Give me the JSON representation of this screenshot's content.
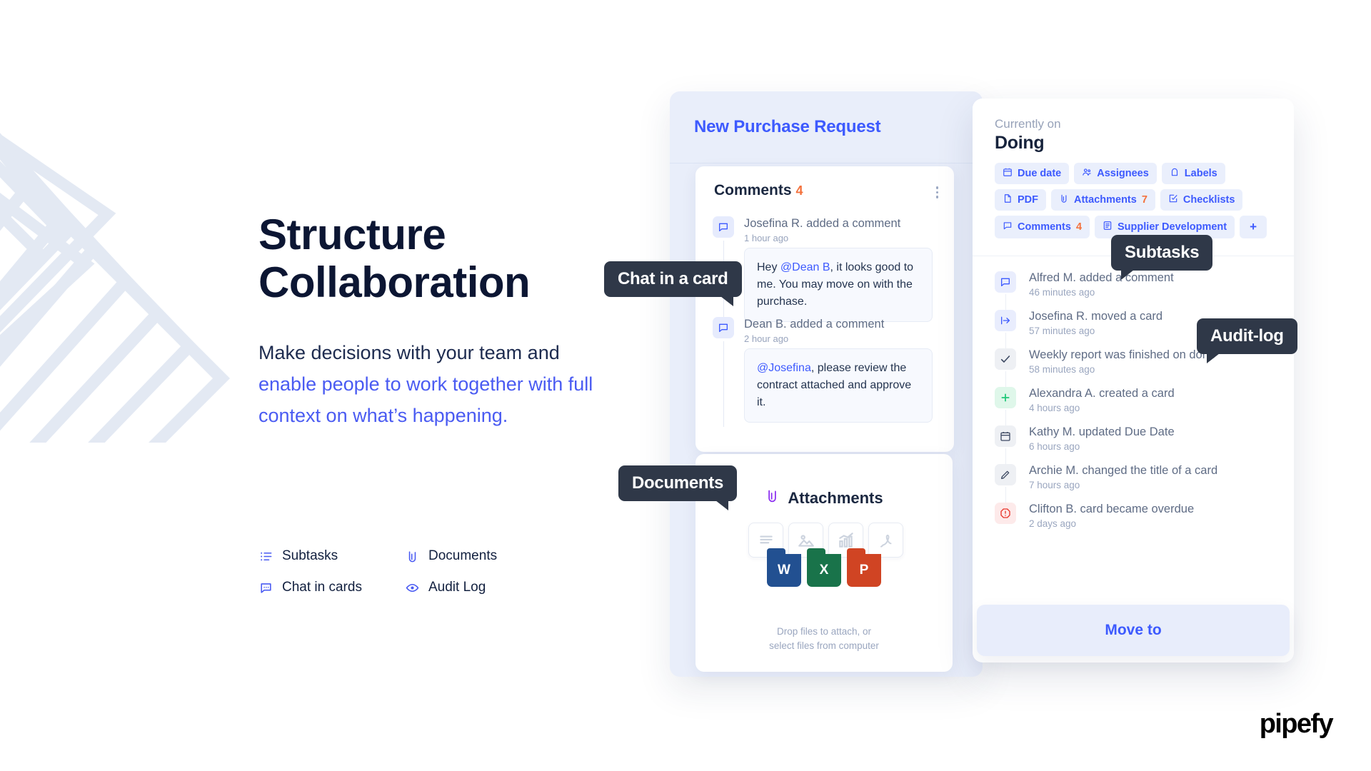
{
  "hero": {
    "headline_line1": "Structure",
    "headline_line2": "Collaboration",
    "sub_part1": "Make decisions with",
    "sub_part2": "your team and ",
    "sub_highlight": "enable people to work together with full context on what’s happening.",
    "accent_color": "#4a5bf2"
  },
  "features": [
    {
      "label": "Subtasks",
      "icon": "list-icon"
    },
    {
      "label": "Documents",
      "icon": "paperclip-icon"
    },
    {
      "label": "Chat in cards",
      "icon": "chat-icon"
    },
    {
      "label": "Audit Log",
      "icon": "eye-icon"
    }
  ],
  "left_card": {
    "title": "New Purchase Request",
    "comments": {
      "heading": "Comments",
      "count": "4",
      "items": [
        {
          "author": "Josefina R. added a comment",
          "time": "1 hour ago",
          "mention": "@Dean B",
          "text_before": "Hey ",
          "text_after": ", it looks good to me. You may move on with the purchase."
        },
        {
          "author": "Dean B. added a comment",
          "time": "2 hour ago",
          "mention": "@Josefina",
          "text_before": "",
          "text_after": ", please review the contract attached and approve it."
        }
      ]
    },
    "attachments": {
      "title": "Attachments",
      "files": [
        {
          "type": "doc-lines-icon"
        },
        {
          "type": "image-icon"
        },
        {
          "type": "chart-icon"
        },
        {
          "type": "pdf-icon"
        }
      ],
      "tags": [
        {
          "letter": "W",
          "color": "#225091"
        },
        {
          "letter": "X",
          "color": "#19734a"
        },
        {
          "letter": "P",
          "color": "#d04423"
        }
      ],
      "drop_line1": "Drop files to attach, or",
      "drop_line2": "select files from computer"
    }
  },
  "right_card": {
    "currently_label": "Currently on",
    "stage": "Doing",
    "chips": [
      {
        "label": "Due date",
        "count": "",
        "icon": "calendar-icon"
      },
      {
        "label": "Assignees",
        "count": "",
        "icon": "people-icon"
      },
      {
        "label": "Labels",
        "count": "",
        "icon": "tag-icon"
      },
      {
        "label": "PDF",
        "count": "",
        "icon": "file-icon"
      },
      {
        "label": "Attachments",
        "count": "7",
        "icon": "paperclip-icon"
      },
      {
        "label": "Checklists",
        "count": "",
        "icon": "checklist-icon"
      },
      {
        "label": "Comments",
        "count": "4",
        "icon": "chat-icon"
      },
      {
        "label": "Supplier Development",
        "count": "",
        "icon": "form-icon"
      },
      {
        "label": "+",
        "count": "",
        "icon": "plus-icon"
      }
    ],
    "activities": [
      {
        "text": "Alfred M. added a comment",
        "time": "46 minutes ago",
        "icon": "chat-icon",
        "bg": "#e9edfd",
        "fg": "#3d5afe"
      },
      {
        "text": "Josefina R. moved a card",
        "time": "57 minutes ago",
        "icon": "move-icon",
        "bg": "#e9edfd",
        "fg": "#3d5afe"
      },
      {
        "text": "Weekly report was finished on done",
        "time": "58 minutes ago",
        "icon": "check-icon",
        "bg": "#eef0f4",
        "fg": "#3e4a63"
      },
      {
        "text": "Alexandra A. created  a card",
        "time": "4 hours ago",
        "icon": "plus-icon",
        "bg": "#dff7ea",
        "fg": "#1ec878"
      },
      {
        "text": "Kathy M. updated Due Date",
        "time": "6 hours ago",
        "icon": "calendar-icon",
        "bg": "#eef0f4",
        "fg": "#3e4a63"
      },
      {
        "text": "Archie M. changed the title of a card",
        "time": "7 hours ago",
        "icon": "pencil-icon",
        "bg": "#eef0f4",
        "fg": "#3e4a63"
      },
      {
        "text": "Clifton B. card became overdue",
        "time": "2 days ago",
        "icon": "alert-icon",
        "bg": "#fdeaea",
        "fg": "#e8342a"
      }
    ],
    "move_to": "Move to"
  },
  "tooltips": {
    "chat": "Chat in a card",
    "documents": "Documents",
    "subtasks": "Subtasks",
    "audit": "Audit-log"
  },
  "brand": {
    "logo": "pipefy"
  }
}
